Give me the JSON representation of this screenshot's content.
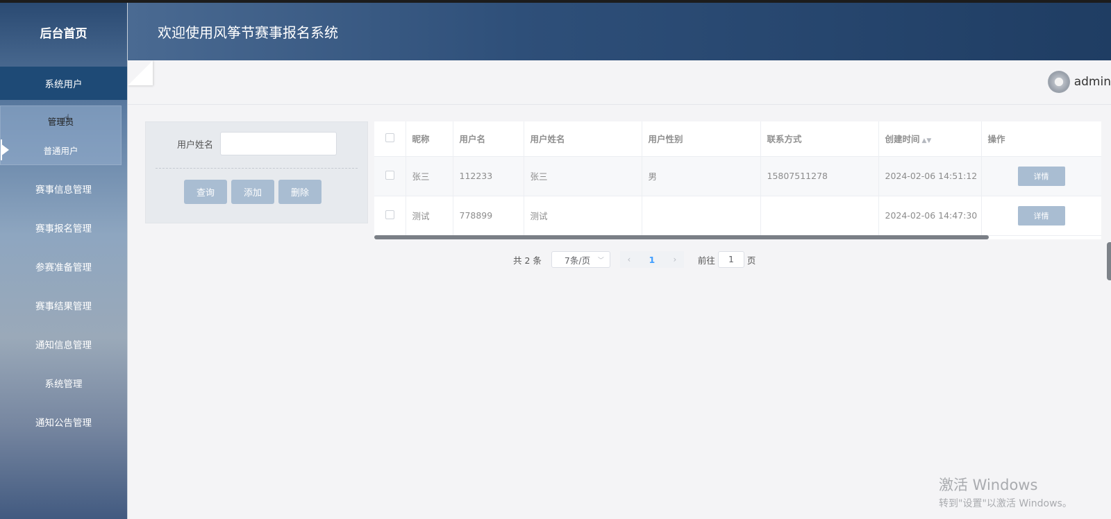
{
  "sidebar": {
    "brand": "后台首页",
    "active_group": "系统用户",
    "submenu": [
      {
        "label": "管理员"
      },
      {
        "label": "普通用户"
      }
    ],
    "items": [
      {
        "label": "赛事信息管理"
      },
      {
        "label": "赛事报名管理"
      },
      {
        "label": "参赛准备管理"
      },
      {
        "label": "赛事结果管理"
      },
      {
        "label": "通知信息管理"
      },
      {
        "label": "系统管理"
      },
      {
        "label": "通知公告管理"
      }
    ]
  },
  "header": {
    "title": "欢迎使用风筝节赛事报名系统"
  },
  "user": {
    "name": "admin"
  },
  "search": {
    "label": "用户姓名",
    "value": "",
    "buttons": {
      "query": "查询",
      "add": "添加",
      "delete": "删除"
    }
  },
  "table": {
    "columns": [
      "昵称",
      "用户名",
      "用户姓名",
      "用户性别",
      "联系方式",
      "创建时间",
      "操作"
    ],
    "rows": [
      {
        "nickname": "张三",
        "username": "112233",
        "realname": "张三",
        "gender": "男",
        "phone": "15807511278",
        "created": "2024-02-06 14:51:12",
        "action": "详情"
      },
      {
        "nickname": "测试",
        "username": "778899",
        "realname": "测试",
        "gender": "",
        "phone": "",
        "created": "2024-02-06 14:47:30",
        "action": "详情"
      }
    ]
  },
  "pagination": {
    "total": "共 2 条",
    "page_size": "7条/页",
    "current_page": "1",
    "goto_label": "前往",
    "goto_value": "1",
    "goto_suffix": "页"
  },
  "watermark": {
    "title": "激活 Windows",
    "subtitle": "转到\"设置\"以激活 Windows。"
  },
  "colors": {
    "sidebar_active": "#1e4a76",
    "button": "#a9bdd2",
    "header_dark": "#1f3d63",
    "pager_active": "#409eff"
  }
}
